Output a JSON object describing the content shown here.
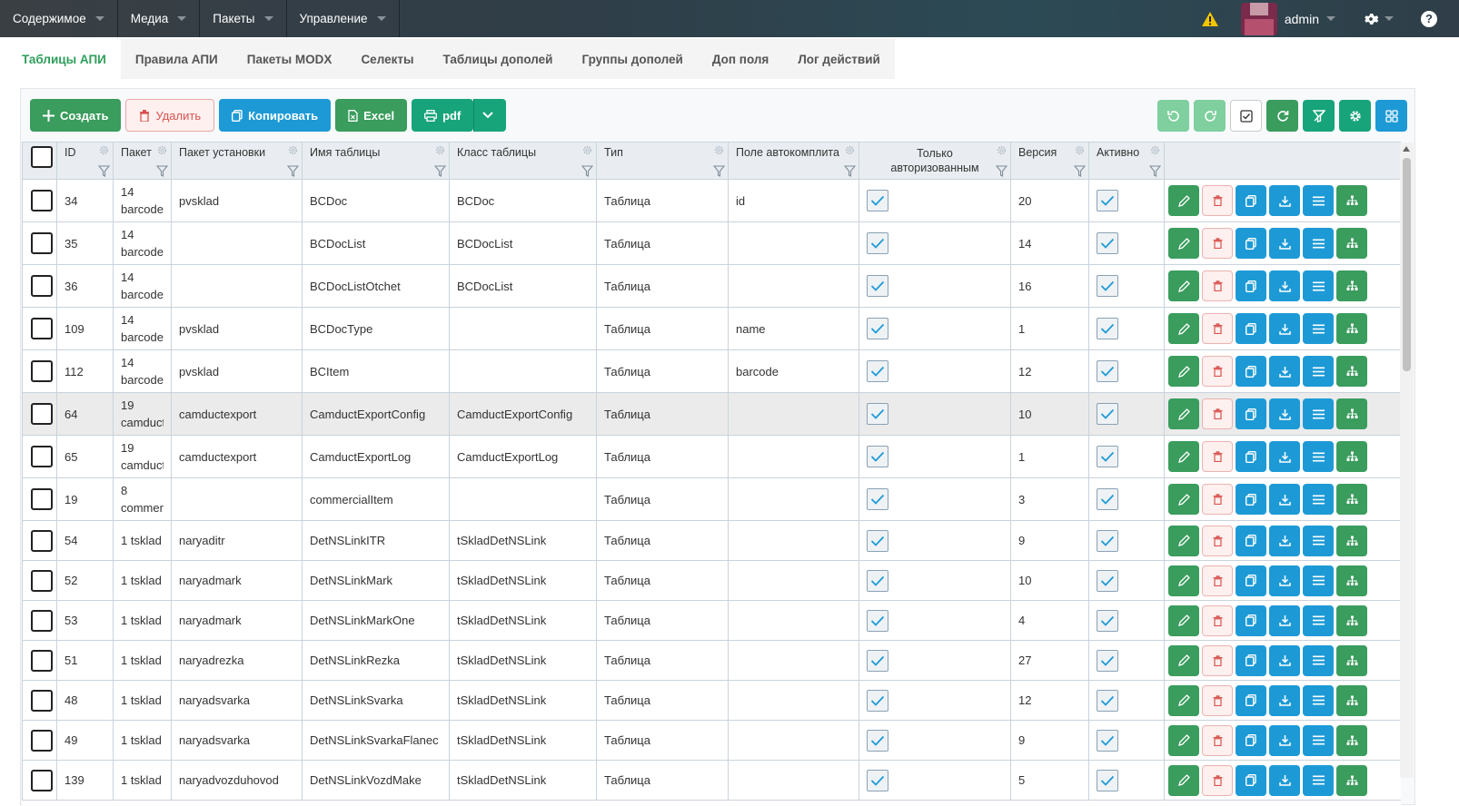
{
  "topmenu": [
    {
      "label": "Содержимое"
    },
    {
      "label": "Медиа"
    },
    {
      "label": "Пакеты"
    },
    {
      "label": "Управление"
    }
  ],
  "user": {
    "name": "admin"
  },
  "tabs": [
    {
      "label": "Таблицы АПИ",
      "active": true
    },
    {
      "label": "Правила АПИ"
    },
    {
      "label": "Пакеты MODX"
    },
    {
      "label": "Селекты"
    },
    {
      "label": "Таблицы дополей"
    },
    {
      "label": "Группы дополей"
    },
    {
      "label": "Доп поля"
    },
    {
      "label": "Лог действий"
    }
  ],
  "toolbar": {
    "create": "Создать",
    "delete": "Удалить",
    "copy": "Копировать",
    "excel": "Excel",
    "pdf": "pdf"
  },
  "columns": [
    "ID",
    "Пакет",
    "Пакет установки",
    "Имя таблицы",
    "Класс таблицы",
    "Тип",
    "Поле автокомплита",
    "Только авторизованным",
    "Версия",
    "Активно"
  ],
  "rows": [
    {
      "id": "34",
      "pkg_num": "14",
      "pkg_name": "barcode",
      "install": "pvsklad",
      "name": "BCDoc",
      "class": "BCDoc",
      "type": "Таблица",
      "autocomplete": "id",
      "version": "20"
    },
    {
      "id": "35",
      "pkg_num": "14",
      "pkg_name": "barcode",
      "install": "",
      "name": "BCDocList",
      "class": "BCDocList",
      "type": "Таблица",
      "autocomplete": "",
      "version": "14"
    },
    {
      "id": "36",
      "pkg_num": "14",
      "pkg_name": "barcode",
      "install": "",
      "name": "BCDocListOtchet",
      "class": "BCDocList",
      "type": "Таблица",
      "autocomplete": "",
      "version": "16"
    },
    {
      "id": "109",
      "pkg_num": "14",
      "pkg_name": "barcode",
      "install": "pvsklad",
      "name": "BCDocType",
      "class": "",
      "type": "Таблица",
      "autocomplete": "name",
      "version": "1"
    },
    {
      "id": "112",
      "pkg_num": "14",
      "pkg_name": "barcode",
      "install": "pvsklad",
      "name": "BCItem",
      "class": "",
      "type": "Таблица",
      "autocomplete": "barcode",
      "version": "12"
    },
    {
      "id": "64",
      "pkg_num": "19",
      "pkg_name": "camductexport",
      "install": "camductexport",
      "name": "CamductExportConfig",
      "class": "CamductExportConfig",
      "type": "Таблица",
      "autocomplete": "",
      "version": "10",
      "highlight": true
    },
    {
      "id": "65",
      "pkg_num": "19",
      "pkg_name": "camductexport",
      "install": "camductexport",
      "name": "CamductExportLog",
      "class": "CamductExportLog",
      "type": "Таблица",
      "autocomplete": "",
      "version": "1"
    },
    {
      "id": "19",
      "pkg_num": "8",
      "pkg_name": "commerceitem",
      "install": "",
      "name": "commercialItem",
      "class": "",
      "type": "Таблица",
      "autocomplete": "",
      "version": "3"
    },
    {
      "id": "54",
      "pkg_single": "1 tsklad",
      "install": "naryaditr",
      "name": "DetNSLinkITR",
      "class": "tSkladDetNSLink",
      "type": "Таблица",
      "autocomplete": "",
      "version": "9"
    },
    {
      "id": "52",
      "pkg_single": "1 tsklad",
      "install": "naryadmark",
      "name": "DetNSLinkMark",
      "class": "tSkladDetNSLink",
      "type": "Таблица",
      "autocomplete": "",
      "version": "10"
    },
    {
      "id": "53",
      "pkg_single": "1 tsklad",
      "install": "naryadmark",
      "name": "DetNSLinkMarkOne",
      "class": "tSkladDetNSLink",
      "type": "Таблица",
      "autocomplete": "",
      "version": "4"
    },
    {
      "id": "51",
      "pkg_single": "1 tsklad",
      "install": "naryadrezka",
      "name": "DetNSLinkRezka",
      "class": "tSkladDetNSLink",
      "type": "Таблица",
      "autocomplete": "",
      "version": "27"
    },
    {
      "id": "48",
      "pkg_single": "1 tsklad",
      "install": "naryadsvarka",
      "name": "DetNSLinkSvarka",
      "class": "tSkladDetNSLink",
      "type": "Таблица",
      "autocomplete": "",
      "version": "12"
    },
    {
      "id": "49",
      "pkg_single": "1 tsklad",
      "install": "naryadsvarka",
      "name": "DetNSLinkSvarkaFlanec",
      "class": "tSkladDetNSLink",
      "type": "Таблица",
      "autocomplete": "",
      "version": "9"
    },
    {
      "id": "139",
      "pkg_single": "1 tsklad",
      "install": "naryadvozduhovod",
      "name": "DetNSLinkVozdMake",
      "class": "tSkladDetNSLink",
      "type": "Таблица",
      "autocomplete": "",
      "version": "5"
    }
  ],
  "colors": {
    "green": "#3a9c5d",
    "blue": "#1d9ad6",
    "teal": "#17a47a",
    "red": "#d9534f",
    "accent_tab": "#2e9e5b"
  }
}
